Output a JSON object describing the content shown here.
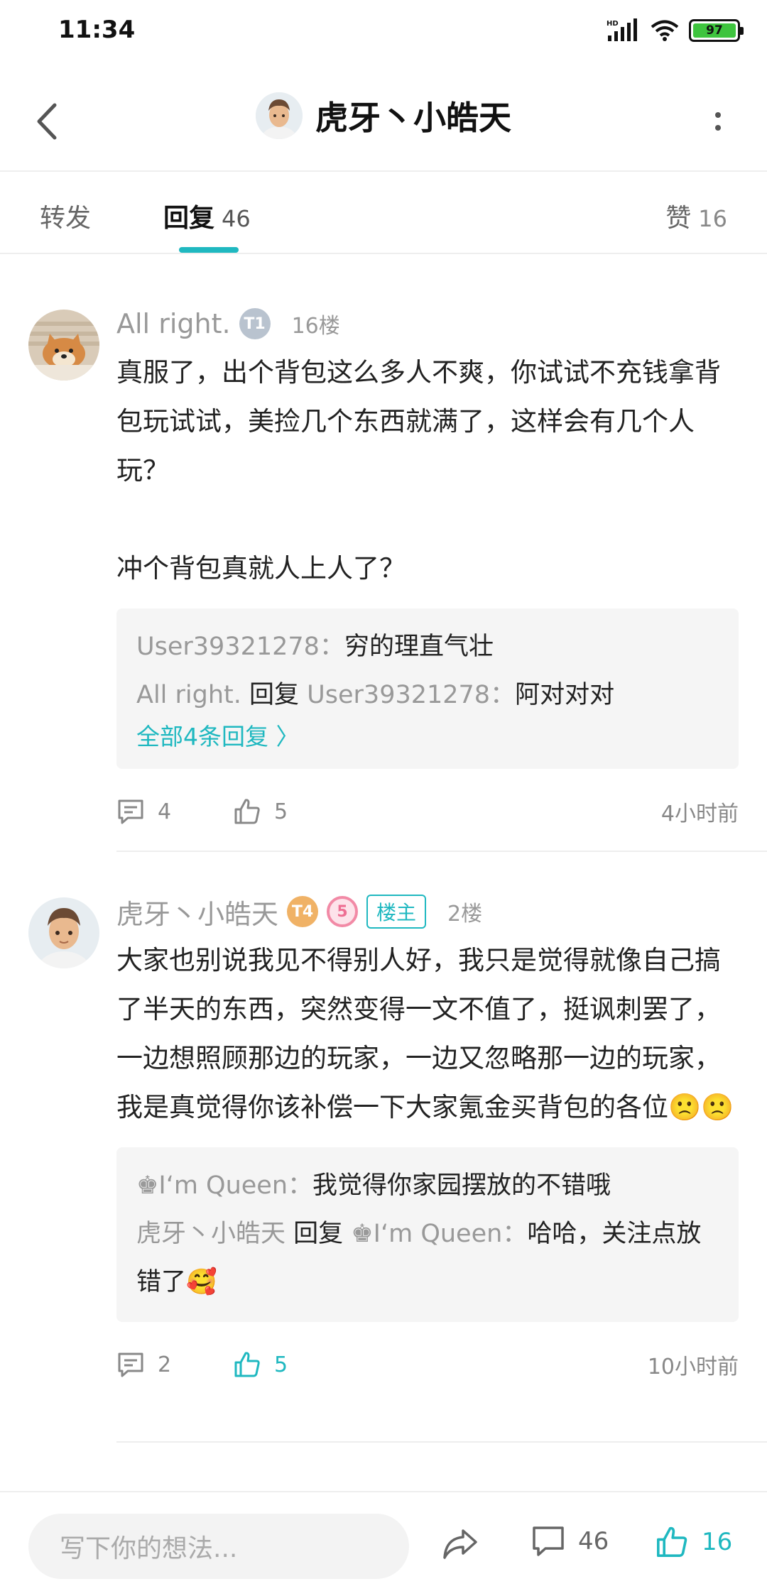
{
  "status": {
    "time": "11:34",
    "battery": "97",
    "network": "HD"
  },
  "header": {
    "title": "虎牙丶小皓天"
  },
  "tabs": {
    "forward": "转发",
    "reply": {
      "label": "回复",
      "count": "46"
    },
    "like": {
      "label": "赞",
      "count": "16"
    }
  },
  "comments": [
    {
      "user": "All right.",
      "level": "T1",
      "floor": "16楼",
      "text": "真服了，出个背包这么多人不爽，你试试不充钱拿背包玩试试，美捡几个东西就满了，这样会有几个人玩？\n\n冲个背包真就人上人了？",
      "replies": [
        {
          "user": "User39321278",
          "sep": "：",
          "text": "穷的理直气壮"
        },
        {
          "user": "All right.",
          "mid": " 回复 ",
          "to": "User39321278",
          "sep": "：",
          "text": "阿对对对"
        }
      ],
      "all_replies": "全部4条回复 〉",
      "comment_count": "4",
      "like_count": "5",
      "time": "4小时前"
    },
    {
      "user": "虎牙丶小皓天",
      "level": "T4",
      "vip": "5",
      "owner_tag": "楼主",
      "floor": "2楼",
      "text": "大家也别说我见不得别人好，我只是觉得就像自己搞了半天的东西，突然变得一文不值了，挺讽刺罢了，一边想照顾那边的玩家，一边又忽略那一边的玩家，我是真觉得你该补偿一下大家氪金买背包的各位🙁🙁",
      "replies": [
        {
          "user": "♚I‘m Queen",
          "sep": "：",
          "text": "我觉得你家园摆放的不错哦"
        },
        {
          "user": "虎牙丶小皓天",
          "mid": " 回复 ",
          "to": "♚I‘m Queen",
          "sep": "：",
          "text": "哈哈，关注点放错了🥰"
        }
      ],
      "comment_count": "2",
      "like_count": "5",
      "liked": true,
      "time": "10小时前"
    }
  ],
  "bottom_bar": {
    "placeholder": "写下你的想法...",
    "comment_count": "46",
    "like_count": "16"
  },
  "colors": {
    "accent": "#1fb8c0",
    "muted": "#999999",
    "reply_bg": "#f5f5f5"
  }
}
